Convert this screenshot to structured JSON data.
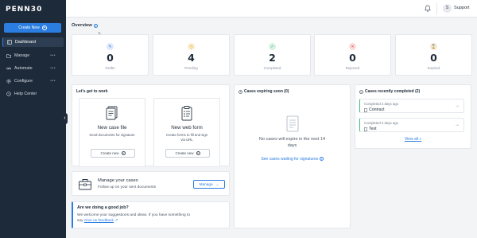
{
  "app": {
    "logo": "PENN30"
  },
  "sidebar": {
    "create_new": "Create New",
    "items": [
      {
        "label": "Dashboard",
        "icon": "dashboard-icon",
        "active": true,
        "dots": ""
      },
      {
        "label": "Manage",
        "icon": "folder-icon",
        "active": false,
        "dots": "•••"
      },
      {
        "label": "Automate",
        "icon": "automate-icon",
        "active": false,
        "dots": "•••"
      },
      {
        "label": "Configure",
        "icon": "gear-icon",
        "active": false,
        "dots": "•••"
      },
      {
        "label": "Help Center",
        "icon": "help-icon",
        "active": false,
        "dots": ""
      }
    ]
  },
  "topbar": {
    "avatar_initial": "S",
    "support_label": "Support"
  },
  "overview": {
    "title": "Overview",
    "stats": [
      {
        "value": "0",
        "label": "Drafts",
        "icon": "pencil-icon",
        "color": "#2b7de0",
        "bg": "#dce9fb"
      },
      {
        "value": "4",
        "label": "Pending",
        "icon": "clock-icon",
        "color": "#e6a21b",
        "bg": "#fbeecf"
      },
      {
        "value": "2",
        "label": "Completed",
        "icon": "check-icon",
        "color": "#2fa86a",
        "bg": "#d7f1e3"
      },
      {
        "value": "0",
        "label": "Rejected",
        "icon": "x-icon",
        "color": "#e0463e",
        "bg": "#fadcda"
      },
      {
        "value": "0",
        "label": "Expired",
        "icon": "hourglass-icon",
        "color": "#e0952b",
        "bg": "#fbe7cf"
      }
    ]
  },
  "work": {
    "title": "Let's get to work",
    "case_file": {
      "title": "New case file",
      "desc": "Send documents for signature",
      "button": "Create new"
    },
    "web_form": {
      "title": "New web form",
      "desc_line1": "Create forms to fill and sign",
      "desc_line2": "via URL",
      "button": "Create new"
    }
  },
  "expiring": {
    "title": "Cases expiring soon (0)",
    "empty_line1": "No cases will expire in the next 14",
    "empty_line2": "days",
    "link": "See cases waiting for signatures"
  },
  "recent": {
    "title": "Cases recently completed (2)",
    "items": [
      {
        "meta": "Completed 2 days ago",
        "name": "Contract"
      },
      {
        "meta": "Completed 4 days ago",
        "name": "Test"
      }
    ],
    "view_all": "View all"
  },
  "manage": {
    "title": "Manage your cases",
    "desc": "Follow up on your sent documents",
    "button": "Manage"
  },
  "feedback": {
    "title": "Are we doing a good job?",
    "line1": "We welcome your suggestions and ideas. If you have something to",
    "line2_prefix": "say",
    "link": "Give us feedback"
  },
  "colors": {
    "sidebar_bg": "#1d2a3a",
    "accent": "#2b7de0",
    "page_bg": "#f3f4f6",
    "success": "#3fbf7f"
  }
}
